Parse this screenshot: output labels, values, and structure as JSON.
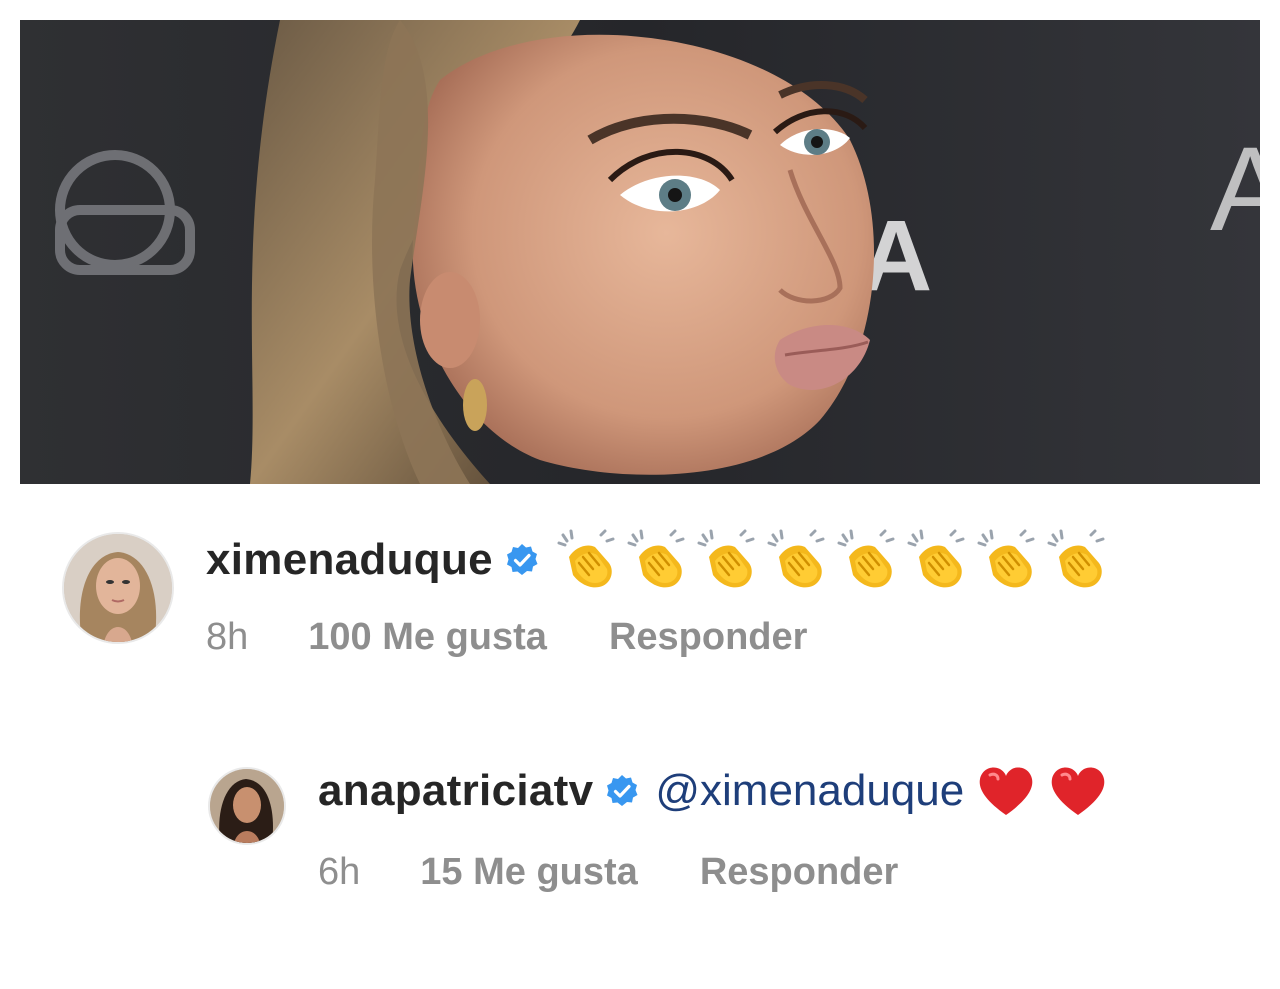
{
  "photo": {
    "alt": ""
  },
  "comments": [
    {
      "username": "ximenaduque",
      "verified": true,
      "text": "",
      "emoji_count": 8,
      "emoji": "clapping-hands",
      "time": "8h",
      "likes": "100 Me gusta",
      "reply": "Responder"
    },
    {
      "username": "anapatriciatv",
      "verified": true,
      "text": "@ximenaduque",
      "emoji_count": 2,
      "emoji": "red-heart",
      "time": "6h",
      "likes": "15 Me gusta",
      "reply": "Responder"
    }
  ],
  "colors": {
    "verified_blue": "#3897f0",
    "mention": "#1e3e7a",
    "meta_gray": "#8e8e8e",
    "username": "#262626"
  }
}
